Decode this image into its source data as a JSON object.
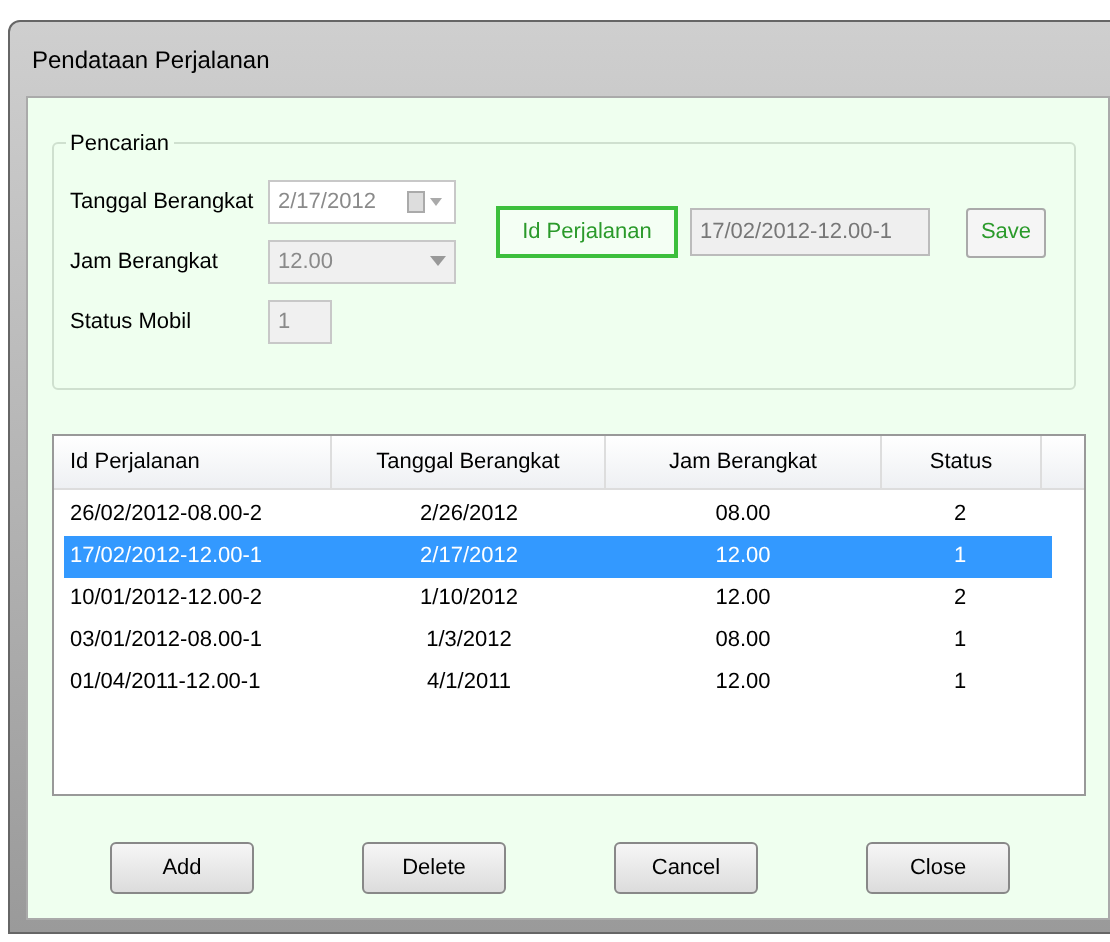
{
  "window": {
    "title": "Pendataan Perjalanan"
  },
  "search": {
    "title": "Pencarian",
    "fields": [
      {
        "kind": "date",
        "label": "Tanggal Berangkat",
        "value": "2/17/2012",
        "disabled": true
      },
      {
        "kind": "combo",
        "label": "Jam Berangkat",
        "value": "12.00",
        "disabled": true
      },
      {
        "kind": "text",
        "label": "Status Mobil",
        "value": "1",
        "disabled": true
      }
    ],
    "id_button": "Id Perjalanan",
    "id_value": "17/02/2012-12.00-1",
    "save_button": "Save"
  },
  "table": {
    "columns": [
      "Id Perjalanan",
      "Tanggal Berangkat",
      "Jam Berangkat",
      "Status"
    ],
    "rows": [
      {
        "cells": [
          "26/02/2012-08.00-2",
          "2/26/2012",
          "08.00",
          "2"
        ],
        "selected": false
      },
      {
        "cells": [
          "17/02/2012-12.00-1",
          "2/17/2012",
          "12.00",
          "1"
        ],
        "selected": true
      },
      {
        "cells": [
          "10/01/2012-12.00-2",
          "1/10/2012",
          "12.00",
          "2"
        ],
        "selected": false
      },
      {
        "cells": [
          "03/01/2012-08.00-1",
          "1/3/2012",
          "08.00",
          "1"
        ],
        "selected": false
      },
      {
        "cells": [
          "01/04/2011-12.00-1",
          "4/1/2011",
          "12.00",
          "1"
        ],
        "selected": false
      }
    ]
  },
  "buttons": [
    "Add",
    "Delete",
    "Cancel",
    "Close"
  ]
}
